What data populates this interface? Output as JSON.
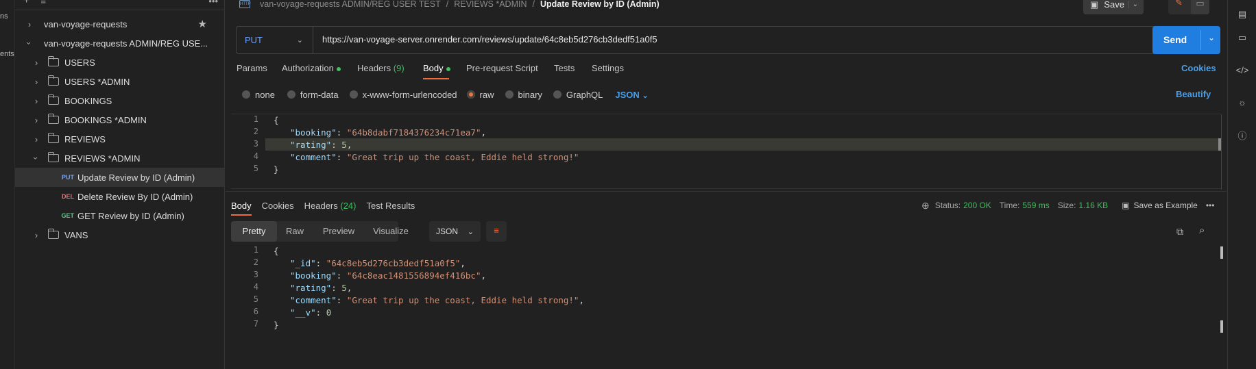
{
  "rail": {
    "labels": [
      "ns",
      "ents"
    ]
  },
  "sidebar": {
    "items": [
      {
        "label": "van-voyage-requests",
        "level": 0,
        "expanded": false
      },
      {
        "label": "van-voyage-requests ADMIN/REG USE...",
        "level": 0,
        "expanded": true
      },
      {
        "label": "USERS",
        "level": 1
      },
      {
        "label": "USERS *ADMIN",
        "level": 1
      },
      {
        "label": "BOOKINGS",
        "level": 1
      },
      {
        "label": "BOOKINGS *ADMIN",
        "level": 1
      },
      {
        "label": "REVIEWS",
        "level": 1
      },
      {
        "label": "REVIEWS *ADMIN",
        "level": 1,
        "expanded": true
      },
      {
        "label": "Update Review by ID (Admin)",
        "method": "PUT",
        "active": true
      },
      {
        "label": "Delete Review By ID (Admin)",
        "method": "DEL"
      },
      {
        "label": "GET Review by ID (Admin)",
        "method": "GET"
      },
      {
        "label": "VANS",
        "level": 1
      }
    ]
  },
  "breadcrumb": {
    "part1": "van-voyage-requests ADMIN/REG USER TEST",
    "sep": "/",
    "part2": "REVIEWS *ADMIN",
    "current": "Update Review by ID (Admin)"
  },
  "toolbar": {
    "save_label": "Save"
  },
  "request": {
    "method": "PUT",
    "url": "https://van-voyage-server.onrender.com/reviews/update/64c8eb5d276cb3dedf51a0f5",
    "send_label": "Send"
  },
  "tabs": {
    "params": "Params",
    "authorization": "Authorization",
    "headers": "Headers",
    "headers_count": "(9)",
    "body": "Body",
    "prerequest": "Pre-request Script",
    "tests": "Tests",
    "settings": "Settings",
    "cookies": "Cookies"
  },
  "body_options": {
    "none": "none",
    "formdata": "form-data",
    "urlencoded": "x-www-form-urlencoded",
    "raw": "raw",
    "binary": "binary",
    "graphql": "GraphQL",
    "format": "JSON",
    "beautify": "Beautify"
  },
  "request_body": [
    {
      "n": "1",
      "t": "{"
    },
    {
      "n": "2",
      "key": "\"booking\"",
      "val": "\"64b8dabf7184376234c71ea7\"",
      "type": "s"
    },
    {
      "n": "3",
      "key": "\"rating\"",
      "val": "5",
      "type": "n"
    },
    {
      "n": "4",
      "key": "\"comment\"",
      "val": "\"Great trip up the coast, Eddie held strong!\"",
      "type": "s"
    },
    {
      "n": "5",
      "t": "}"
    }
  ],
  "response_tabs": {
    "body": "Body",
    "cookies": "Cookies",
    "headers": "Headers",
    "headers_count": "(24)",
    "tests": "Test Results"
  },
  "response_meta": {
    "status_label": "Status:",
    "status_value": "200 OK",
    "time_label": "Time:",
    "time_value": "559 ms",
    "size_label": "Size:",
    "size_value": "1.16 KB",
    "save_example": "Save as Example"
  },
  "view_modes": {
    "pretty": "Pretty",
    "raw": "Raw",
    "preview": "Preview",
    "visualize": "Visualize",
    "format": "JSON"
  },
  "response_body": [
    {
      "n": "1",
      "t": "{"
    },
    {
      "n": "2",
      "key": "\"_id\"",
      "val": "\"64c8eb5d276cb3dedf51a0f5\"",
      "type": "s"
    },
    {
      "n": "3",
      "key": "\"booking\"",
      "val": "\"64c8eac1481556894ef416bc\"",
      "type": "s"
    },
    {
      "n": "4",
      "key": "\"rating\"",
      "val": "5",
      "type": "n"
    },
    {
      "n": "5",
      "key": "\"comment\"",
      "val": "\"Great trip up the coast, Eddie held strong!\"",
      "type": "s"
    },
    {
      "n": "6",
      "key": "\"__v\"",
      "val": "0",
      "type": "n",
      "last": true
    },
    {
      "n": "7",
      "t": "}"
    }
  ],
  "colors": {
    "accent": "#1f7ee0",
    "orange": "#f26b3a",
    "green": "#3fbf5f",
    "put": "#6da3ff",
    "del": "#f07178",
    "get": "#5fc98b"
  }
}
